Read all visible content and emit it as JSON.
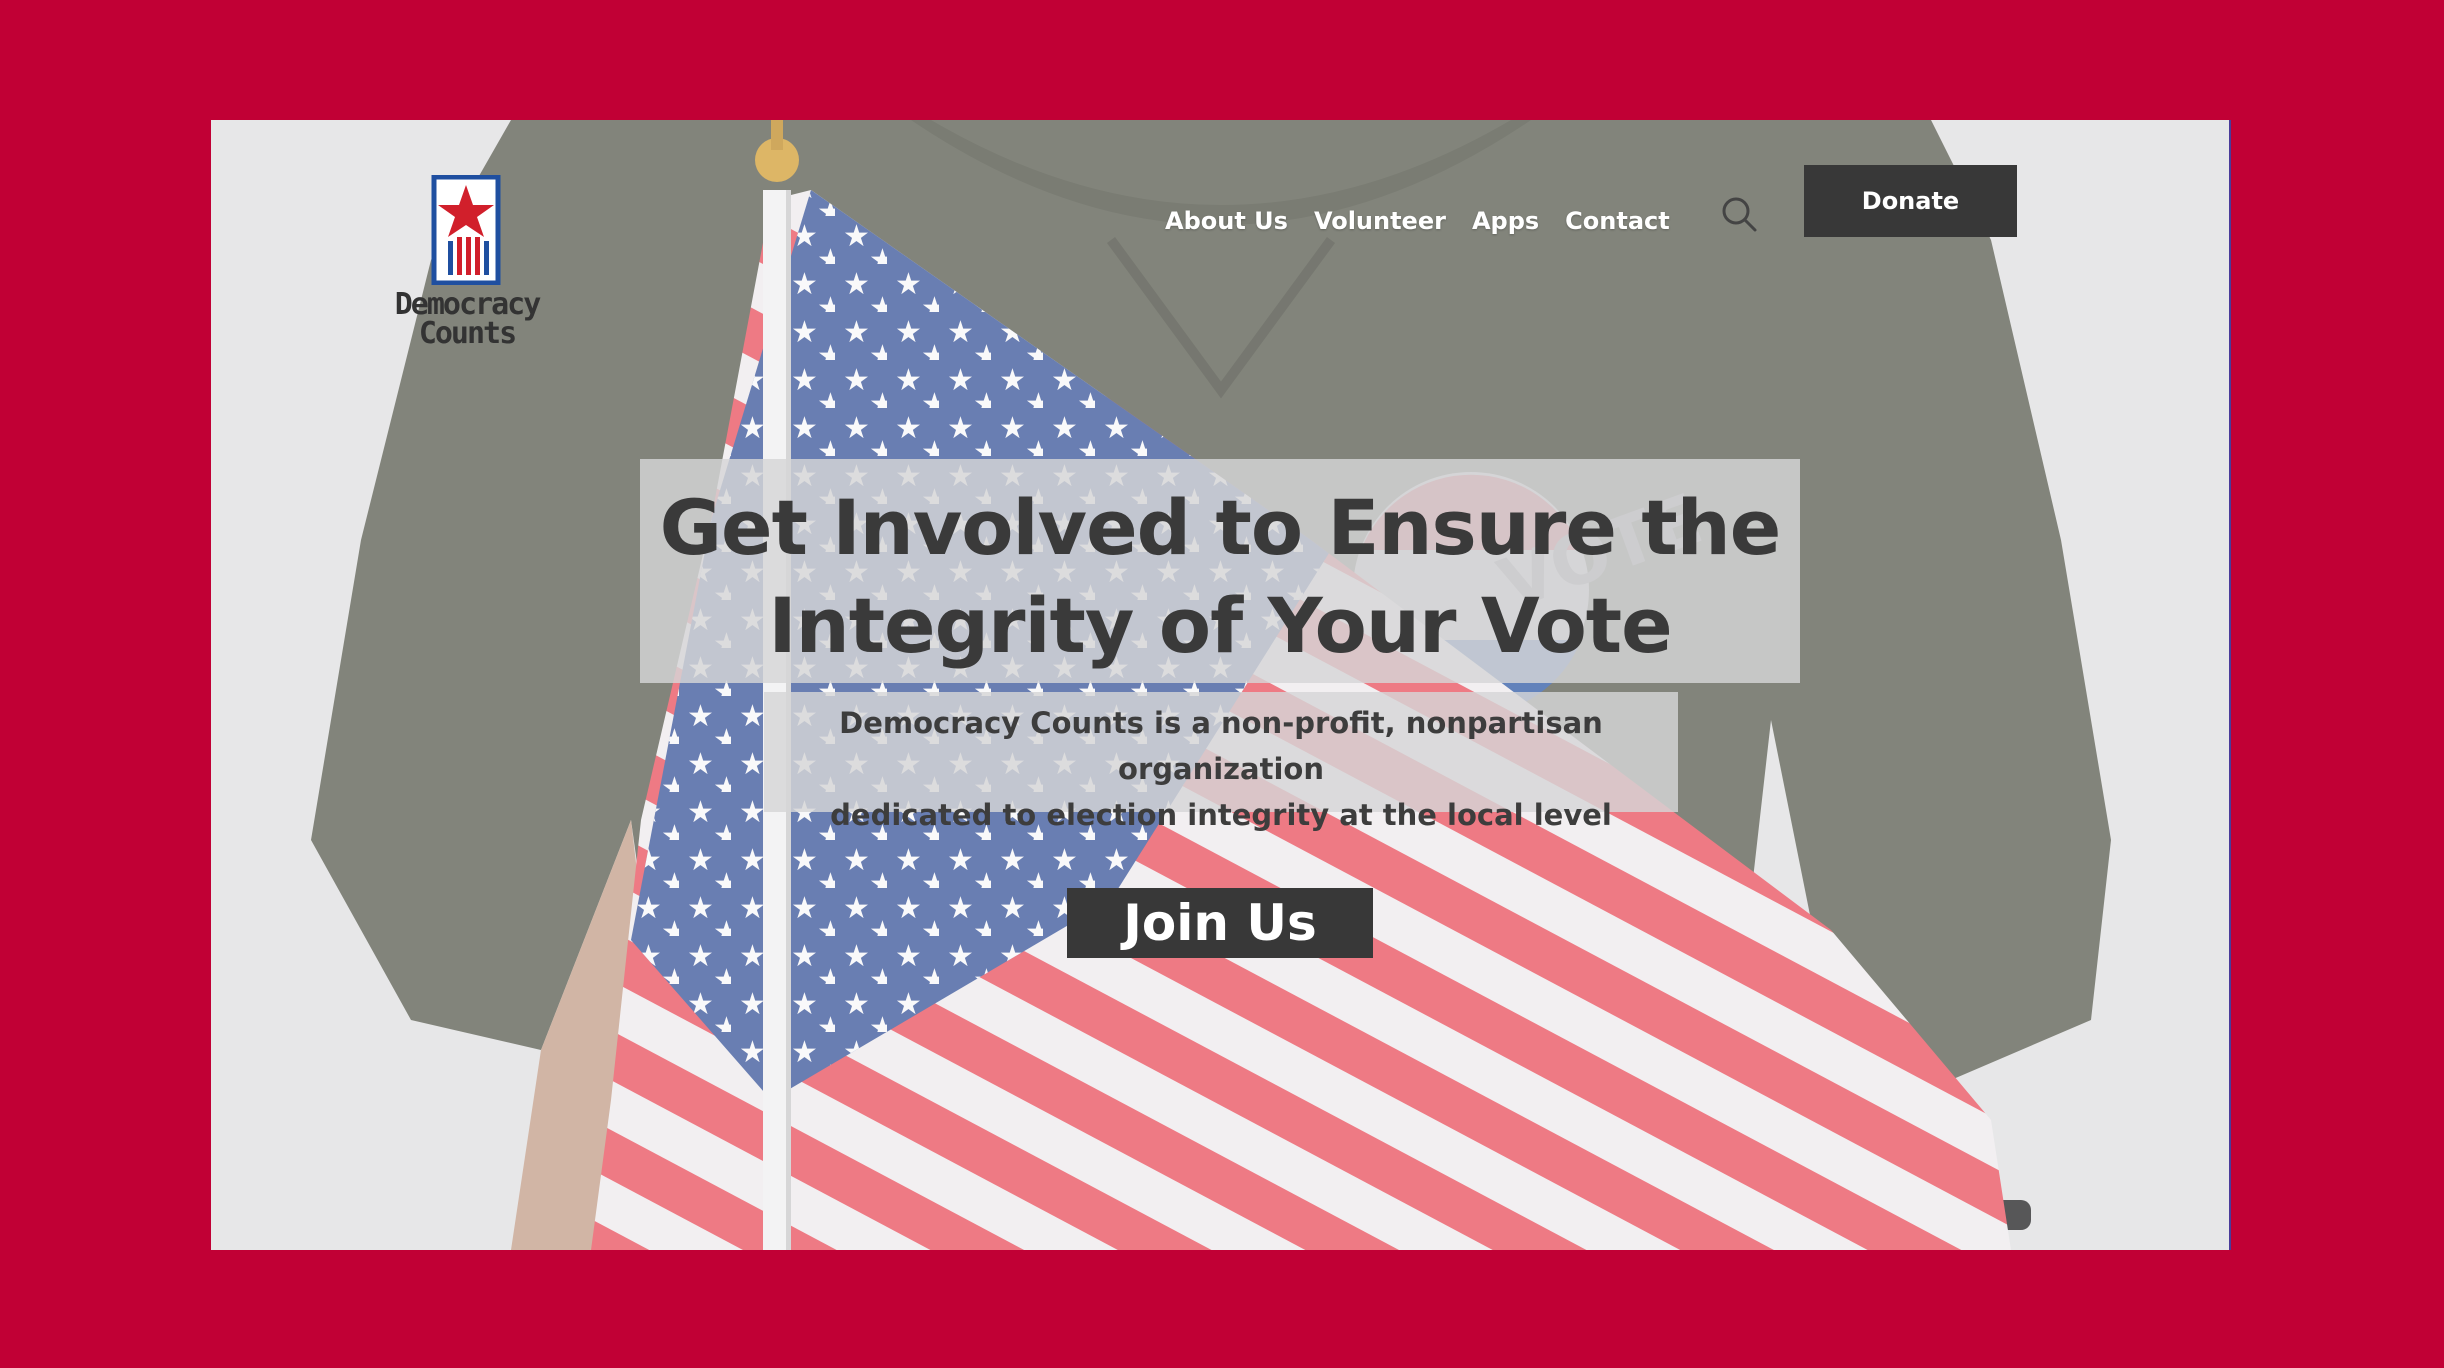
{
  "brand": {
    "name_line1": "Democracy",
    "name_line2": "Counts",
    "colors": {
      "red": "#c10035",
      "blue": "#1f4fa0",
      "dark": "#383838"
    }
  },
  "nav": {
    "items": [
      {
        "label": "About Us"
      },
      {
        "label": "Volunteer"
      },
      {
        "label": "Apps"
      },
      {
        "label": "Contact"
      }
    ],
    "search_icon": "search-icon",
    "donate_label": "Donate"
  },
  "hero": {
    "headline_line1": "Get Involved to Ensure the",
    "headline_line2": "Integrity of Your Vote",
    "subtext_line1": "Democracy Counts is a non-profit, nonpartisan organization",
    "subtext_line2": "dedicated to election integrity at the local level",
    "cta_label": "Join Us",
    "button_text": "VOTE"
  }
}
